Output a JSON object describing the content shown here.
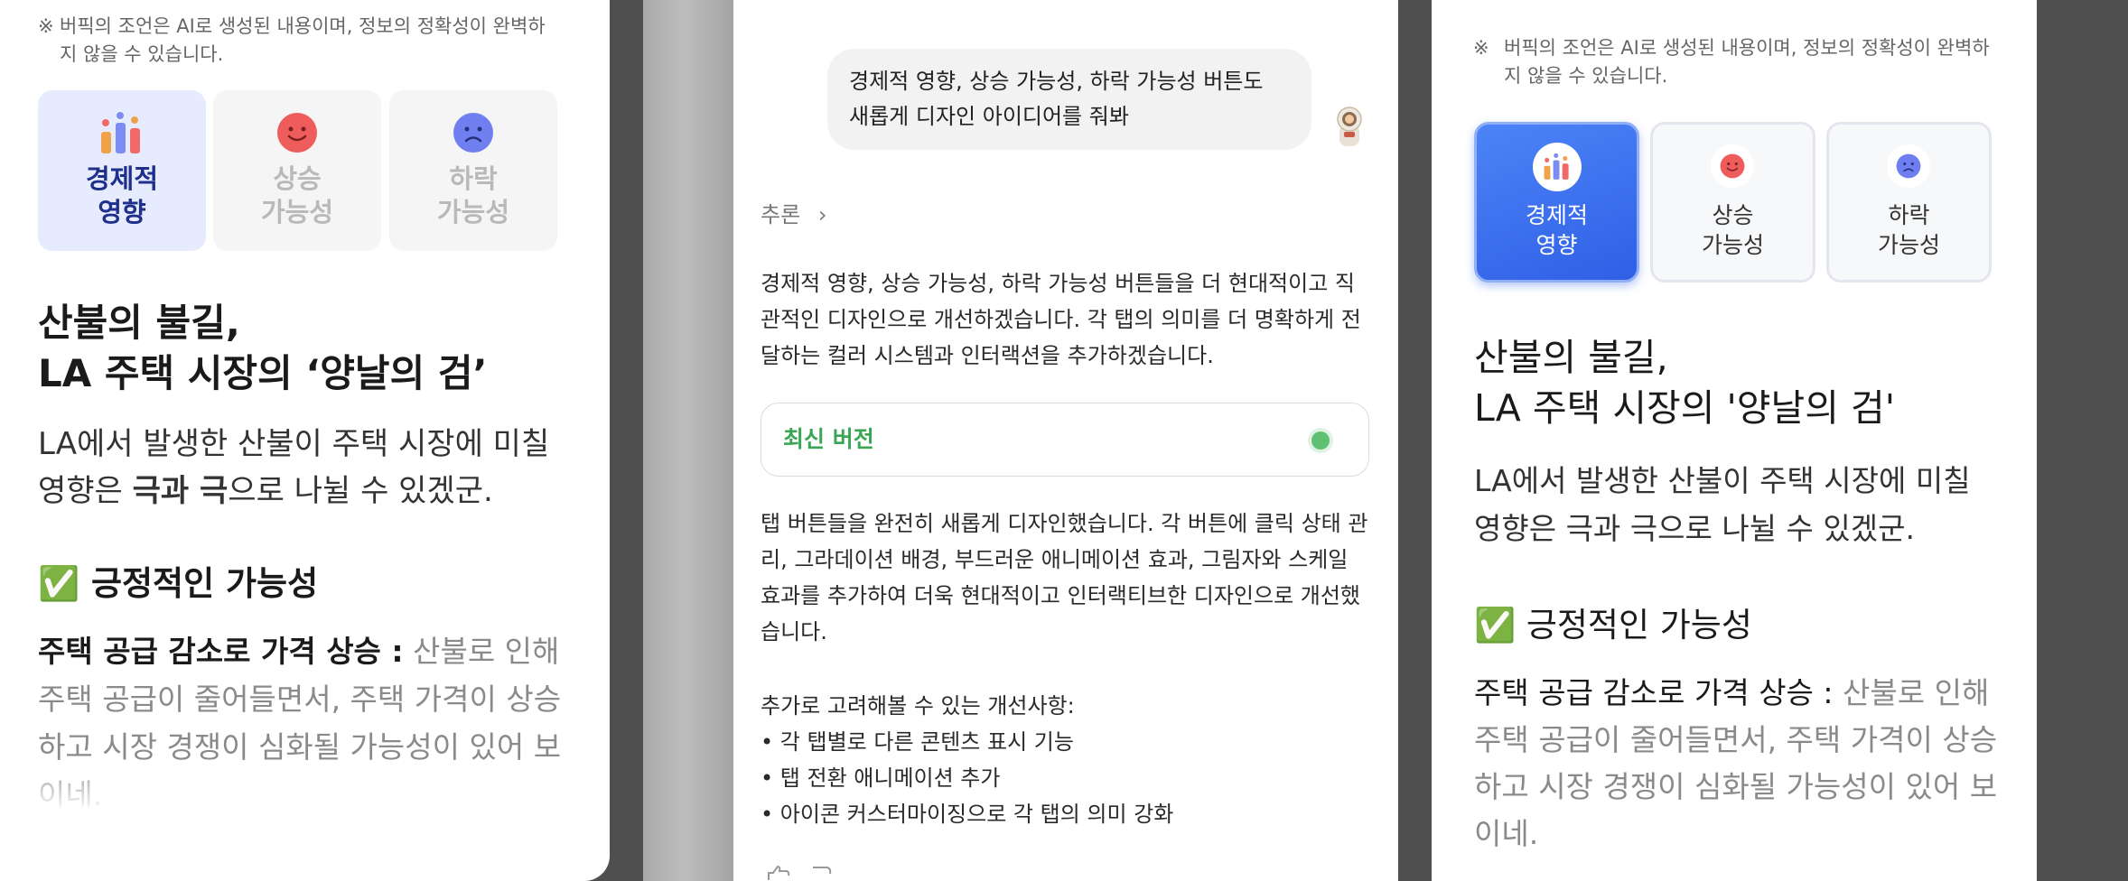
{
  "left": {
    "notice": {
      "mark": "※",
      "text": "버픽의 조언은 AI로 생성된 내용이며, 정보의 정확성이 완벽하지 않을 수 있습니다."
    },
    "tabs": [
      {
        "label": "경제적\n영향",
        "icon": "bar-chart-icon",
        "active": true
      },
      {
        "label": "상승\n가능성",
        "icon": "smile-face-icon",
        "active": false
      },
      {
        "label": "하락\n가능성",
        "icon": "sad-face-icon",
        "active": false
      }
    ],
    "title_line1": "산불의 불길,",
    "title_line2": "LA 주택 시장의 ‘양날의 검’",
    "lead_a": "LA에서 발생한 산불이 주택 시장에 미칠 영향은 ",
    "lead_b": "극과 극",
    "lead_c": "으로 나뉠 수 있겠군.",
    "section_emoji": "✅",
    "section_title": "긍정적인 가능성",
    "para_bold": "주택 공급 감소로 가격 상승 :",
    "para_text": " 산불로 인해 주택 공급이 줄어들면서, 주택 가격이 상승하고 시장 경쟁이 심화될 가능성이 있어 보이네."
  },
  "chat": {
    "user_message": "경제적 영향, 상승 가능성, 하락 가능성 버튼도 새롭게 디자인 아이디어를 줘봐",
    "user_avatar": "astronaut-avatar",
    "reasoning_label": "추론",
    "intro": "경제적 영향, 상승 가능성, 하락 가능성 버튼들을 더 현대적이고 직관적인 디자인으로 개선하겠습니다. 각 탭의 의미를 더 명확하게 전달하는 컬러 시스템과 인터랙션을 추가하겠습니다.",
    "version_label": "최신 버전",
    "version_color": "#3aa655",
    "result": "탭 버튼들을 완전히 새롭게 디자인했습니다. 각 버튼에 클릭 상태 관리, 그라데이션 배경, 부드러운 애니메이션 효과, 그림자와 스케일 효과를 추가하여 더욱 현대적이고 인터랙티브한 디자인으로 개선했습니다.",
    "suggest_title": "추가로 고려해볼 수 있는 개선사항:",
    "suggestions": [
      "• 각 탭별로 다른 콘텐츠 표시 기능",
      "• 탭 전환 애니메이션 추가",
      "• 아이콘 커스터마이징으로 각 탭의 의미 강화"
    ]
  },
  "right": {
    "notice": {
      "mark": "※",
      "text": "버픽의 조언은 AI로 생성된 내용이며, 정보의 정확성이 완벽하지 않을 수 있습니다."
    },
    "tabs": [
      {
        "label": "경제적\n영향",
        "icon": "bar-chart-icon",
        "active": true
      },
      {
        "label": "상승\n가능성",
        "icon": "smile-face-icon",
        "active": false
      },
      {
        "label": "하락\n가능성",
        "icon": "sad-face-icon",
        "active": false
      }
    ],
    "title_line1": "산불의 불길,",
    "title_line2": "LA 주택 시장의 '양날의 검'",
    "lead": "LA에서 발생한 산불이 주택 시장에 미칠 영향은 극과 극으로 나뉠 수 있겠군.",
    "section_emoji": "✅",
    "section_title": "긍정적인 가능성",
    "para_bold": "주택 공급 감소로 가격 상승 :",
    "para_text": " 산불로 인해 주택 공급이 줄어들면서, 주택 가격이 상승하고 시장 경쟁이 심화될 가능성이 있어 보이네."
  },
  "colors": {
    "active_tab_light": "#e6ecfd",
    "active_tab_text": "#1f2f8c",
    "active_tab_blue": "#3a6ff2",
    "inactive_tab": "#f5f5f5"
  }
}
